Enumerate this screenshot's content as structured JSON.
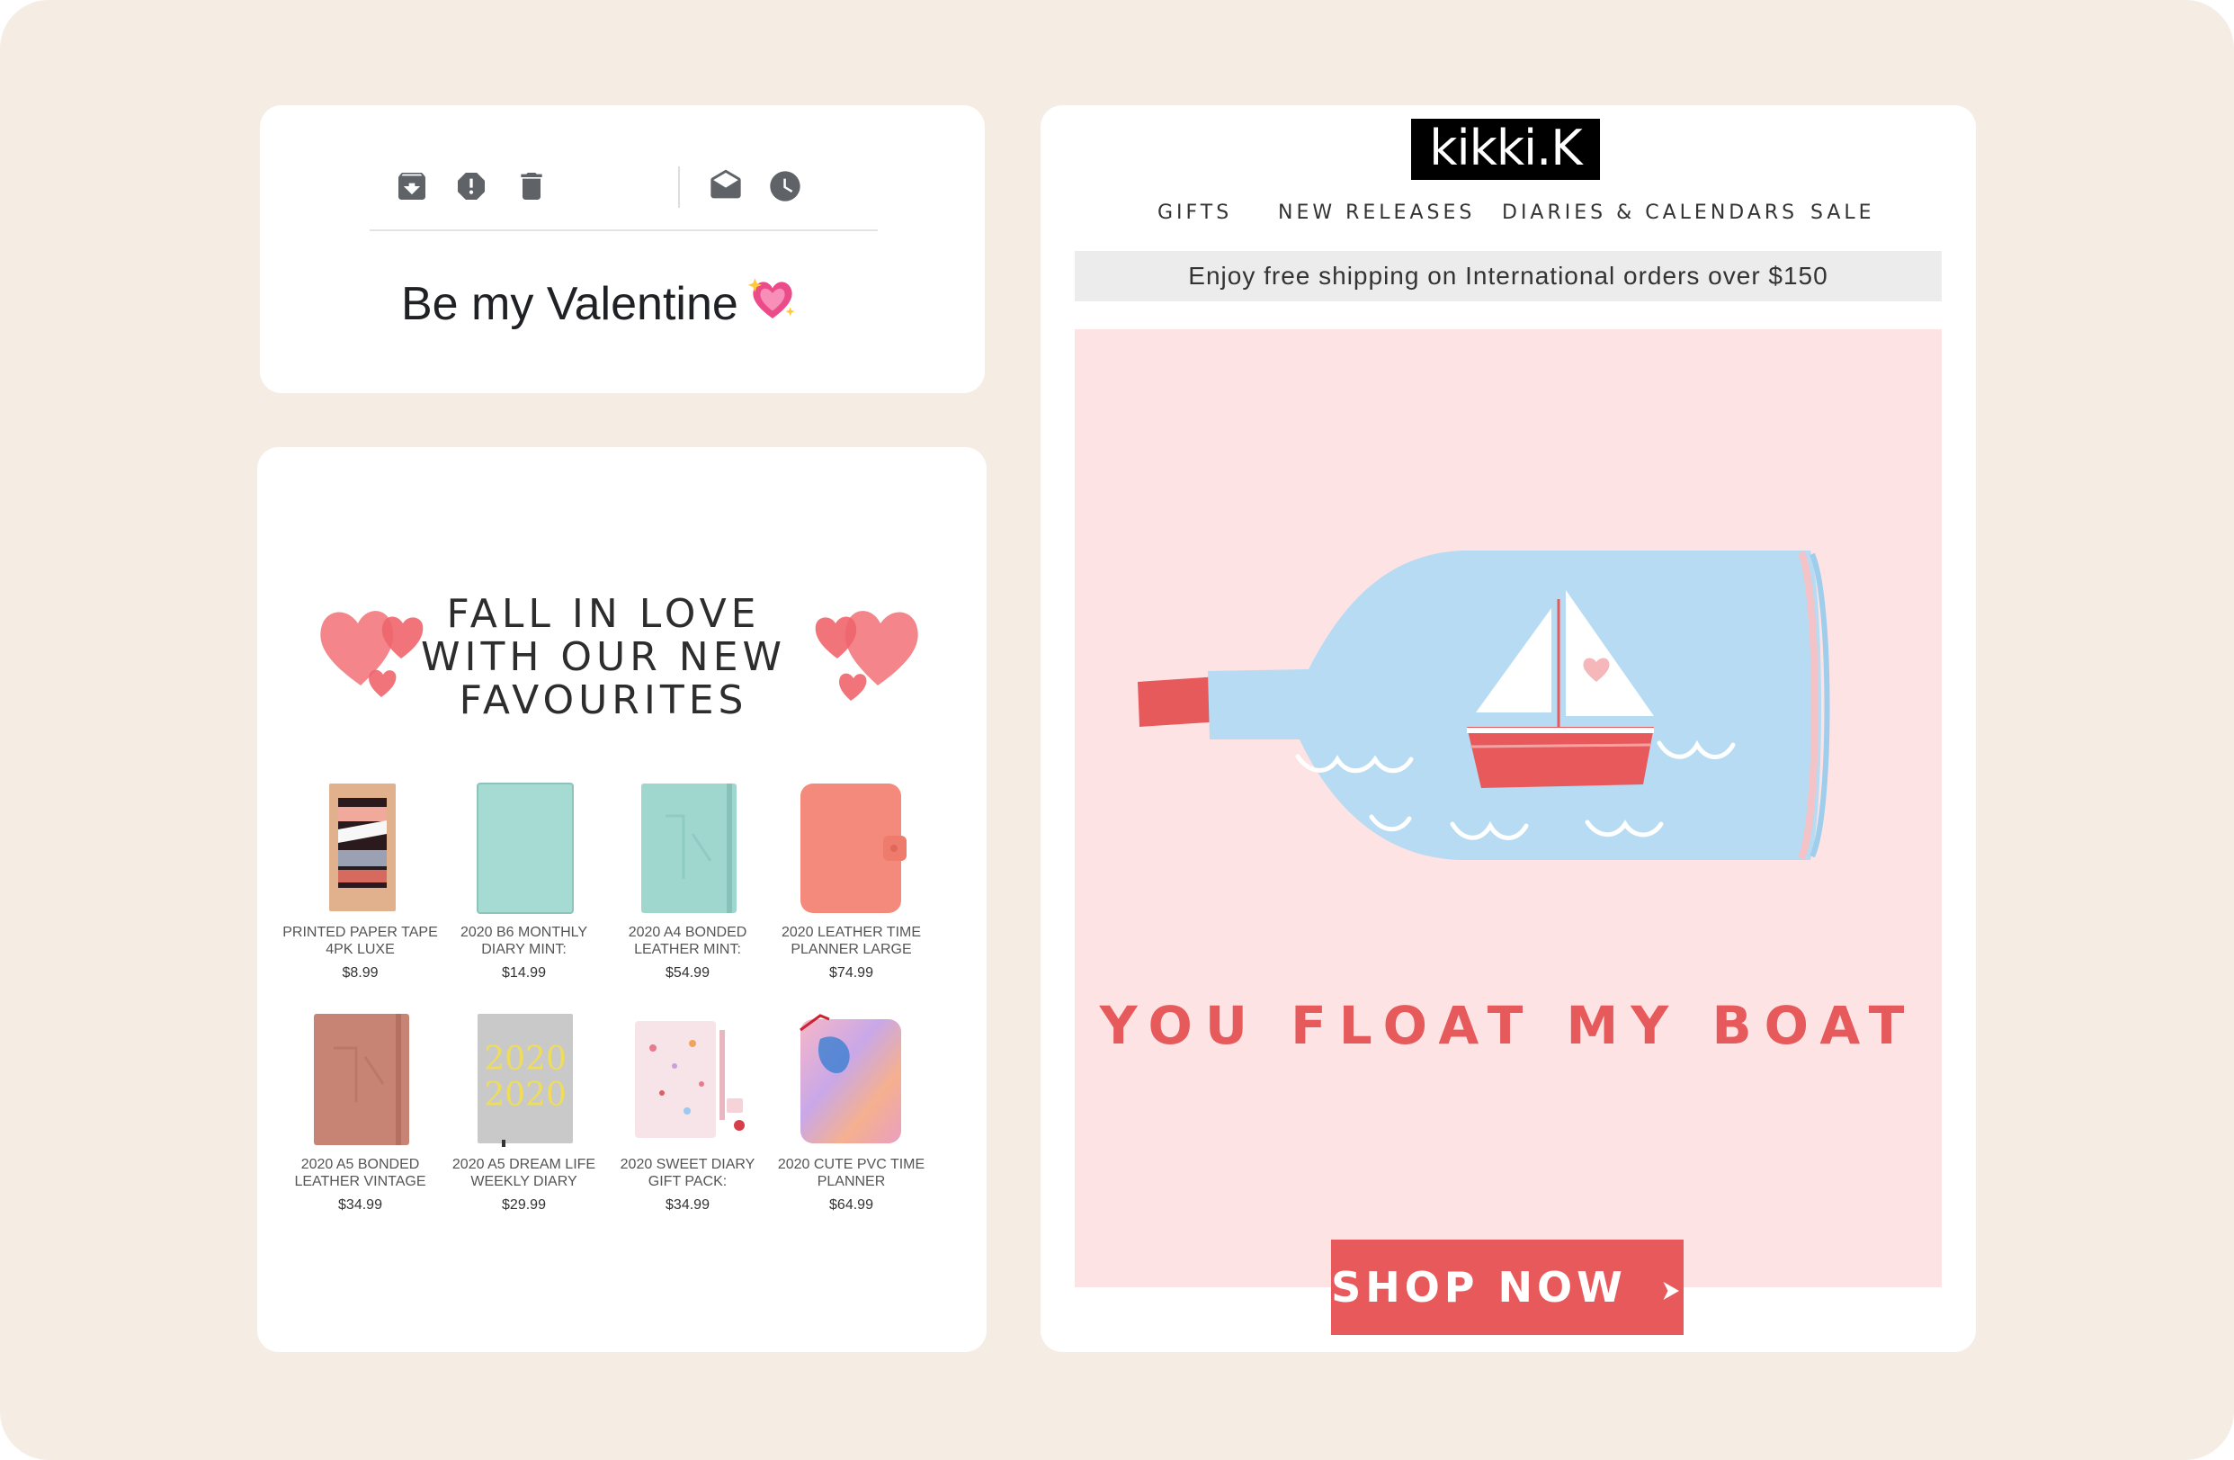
{
  "toolbar": {
    "icons": [
      "archive-icon",
      "report-spam-icon",
      "delete-icon",
      "mark-as-unread-icon",
      "snooze-icon"
    ]
  },
  "email": {
    "subject": "Be my Valentine",
    "subject_emoji": "sparkling-heart-icon"
  },
  "promo": {
    "title_lines": [
      "FALL IN LOVE",
      "WITH OUR NEW",
      "FAVOURITES"
    ],
    "products": [
      {
        "name": "PRINTED PAPER TAPE 4PK LUXE",
        "price": "$8.99"
      },
      {
        "name": "2020 B6 MONTHLY DIARY MINT:",
        "price": "$14.99"
      },
      {
        "name": "2020 A4 BONDED LEATHER MINT:",
        "price": "$54.99"
      },
      {
        "name": "2020 LEATHER TIME PLANNER LARGE",
        "price": "$74.99"
      },
      {
        "name": "2020 A5 BONDED LEATHER VINTAGE",
        "price": "$34.99"
      },
      {
        "name": "2020 A5 DREAM LIFE WEEKLY DIARY",
        "price": "$29.99"
      },
      {
        "name": "2020 SWEET DIARY GIFT PACK:",
        "price": "$34.99"
      },
      {
        "name": "2020 CUTE PVC TIME PLANNER",
        "price": "$64.99"
      }
    ],
    "diary_cover_text": "2020"
  },
  "kikki": {
    "logo": "kikki.K",
    "nav": [
      "GIFTS",
      "NEW RELEASES",
      "DIARIES & CALENDARS",
      "SALE"
    ],
    "shipping_banner": "Enjoy free shipping on International orders over $150",
    "tagline": "YOU FLOAT MY BOAT",
    "cta": "SHOP NOW"
  },
  "colors": {
    "background": "#f5ede4",
    "hero_pink": "#fde3e4",
    "accent_red": "#e8595b",
    "bottle_blue": "#b6dbf2",
    "mint": "#9fd7cf",
    "coral": "#f48a7b"
  }
}
